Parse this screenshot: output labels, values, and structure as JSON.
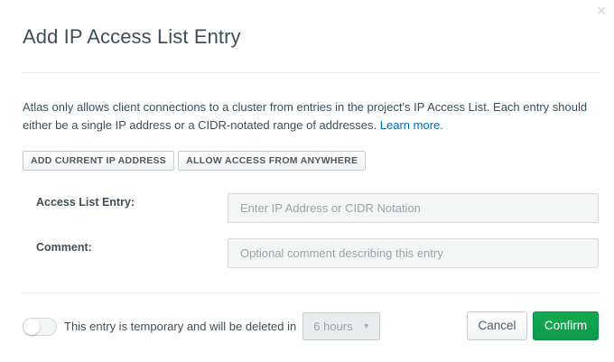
{
  "modal": {
    "title": "Add IP Access List Entry",
    "close_glyph": "×",
    "description": "Atlas only allows client connections to a cluster from entries in the project's IP Access List. Each entry should either be a single IP address or a CIDR-notated range of addresses.",
    "learn_more": "Learn more."
  },
  "quick_actions": {
    "add_current_ip": "ADD CURRENT IP ADDRESS",
    "allow_anywhere": "ALLOW ACCESS FROM ANYWHERE"
  },
  "form": {
    "entry_label": "Access List Entry:",
    "entry_value": "",
    "entry_placeholder": "Enter IP Address or CIDR Notation",
    "comment_label": "Comment:",
    "comment_value": "",
    "comment_placeholder": "Optional comment describing this entry"
  },
  "footer": {
    "temporary_toggle_on": false,
    "temporary_label": "This entry is temporary and will be deleted in",
    "duration_selected": "6 hours",
    "duration_caret": "▼",
    "cancel_label": "Cancel",
    "confirm_label": "Confirm"
  },
  "colors": {
    "confirm_green": "#13aa52",
    "link_blue": "#006cbc",
    "text": "#3d4f58"
  }
}
